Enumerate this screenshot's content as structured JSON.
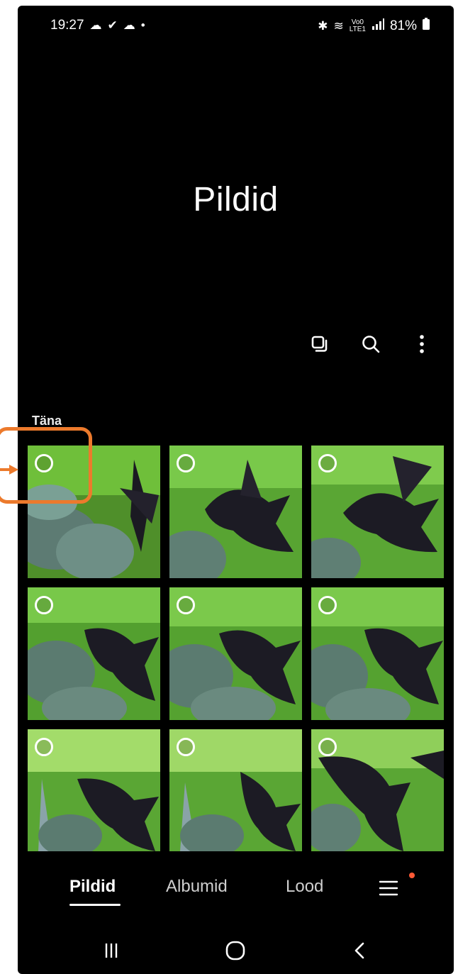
{
  "status_bar": {
    "time": "19:27",
    "battery": "81%",
    "net_top": "Vo0",
    "net_bottom": "LTE1"
  },
  "header": {
    "title": "Pildid"
  },
  "toolbar": {
    "icons": [
      "select-multiple-icon",
      "search-icon",
      "more-options-icon"
    ]
  },
  "section": {
    "label": "Täna"
  },
  "bottom_nav": {
    "tabs": [
      {
        "label": "Pildid",
        "active": true
      },
      {
        "label": "Albumid",
        "active": false
      },
      {
        "label": "Lood",
        "active": false
      }
    ],
    "menu_icon": "hamburger-menu-icon",
    "badge_color": "#ff5a36"
  },
  "system_nav": {
    "icons": [
      "recent-apps-icon",
      "home-icon",
      "back-icon"
    ]
  },
  "colors": {
    "background": "#000000",
    "text": "#ffffff",
    "highlight": "#ec7a2c",
    "foliage": "#5fae2e"
  }
}
